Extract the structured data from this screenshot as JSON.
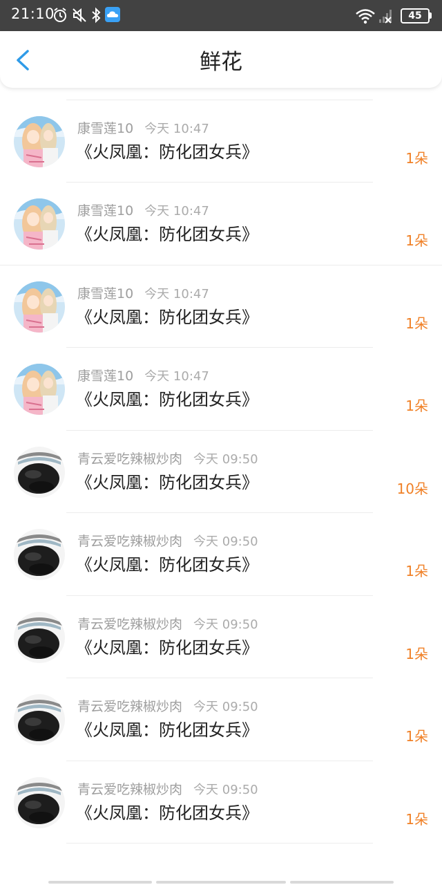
{
  "status_bar": {
    "time": "21:10",
    "battery": "45",
    "icons": [
      "alarm-icon",
      "mute-icon",
      "bluetooth-icon",
      "cloud-app-icon",
      "wifi-icon",
      "signal-icon",
      "battery-icon"
    ]
  },
  "header": {
    "title": "鲜花",
    "back_icon": "chevron-left-icon",
    "accent_color": "#2f9be8"
  },
  "colors": {
    "count": "#f08026",
    "meta": "#9e9e9e",
    "title": "#222222"
  },
  "records": [
    {
      "avatar": "anime-avatar",
      "name": "",
      "time": "",
      "title": "《火凤凰：防化团女兵》",
      "count": "1朵"
    },
    {
      "avatar": "anime-avatar",
      "name": "康雪莲10",
      "time": "今天 10:47",
      "title": "《火凤凰：防化团女兵》",
      "count": "1朵"
    },
    {
      "avatar": "anime-avatar",
      "name": "康雪莲10",
      "time": "今天 10:47",
      "title": "《火凤凰：防化团女兵》",
      "count": "1朵"
    },
    {
      "avatar": "anime-avatar",
      "name": "康雪莲10",
      "time": "今天 10:47",
      "title": "《火凤凰：防化团女兵》",
      "count": "1朵"
    },
    {
      "avatar": "anime-avatar",
      "name": "康雪莲10",
      "time": "今天 10:47",
      "title": "《火凤凰：防化团女兵》",
      "count": "1朵"
    },
    {
      "avatar": "dark-avatar",
      "name": "青云爱吃辣椒炒肉",
      "time": "今天 09:50",
      "title": "《火凤凰：防化团女兵》",
      "count": "10朵"
    },
    {
      "avatar": "dark-avatar",
      "name": "青云爱吃辣椒炒肉",
      "time": "今天 09:50",
      "title": "《火凤凰：防化团女兵》",
      "count": "1朵"
    },
    {
      "avatar": "dark-avatar",
      "name": "青云爱吃辣椒炒肉",
      "time": "今天 09:50",
      "title": "《火凤凰：防化团女兵》",
      "count": "1朵"
    },
    {
      "avatar": "dark-avatar",
      "name": "青云爱吃辣椒炒肉",
      "time": "今天 09:50",
      "title": "《火凤凰：防化团女兵》",
      "count": "1朵"
    },
    {
      "avatar": "dark-avatar",
      "name": "青云爱吃辣椒炒肉",
      "time": "今天 09:50",
      "title": "《火凤凰：防化团女兵》",
      "count": "1朵"
    }
  ]
}
